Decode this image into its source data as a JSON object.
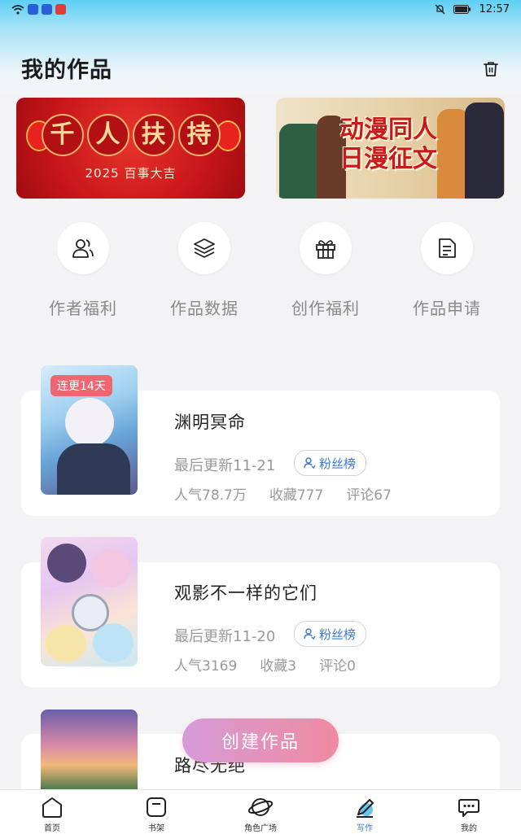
{
  "status_bar": {
    "time": "12:57"
  },
  "page": {
    "title": "我的作品"
  },
  "banners": [
    {
      "title": "千人扶持",
      "subtitle": "2025 百事大吉"
    },
    {
      "title_line1": "动漫同人",
      "title_line2": "日漫征文"
    }
  ],
  "features": [
    {
      "label": "作者福利",
      "icon": "user-group-icon"
    },
    {
      "label": "作品数据",
      "icon": "layers-icon"
    },
    {
      "label": "创作福利",
      "icon": "gift-icon"
    },
    {
      "label": "作品申请",
      "icon": "document-icon"
    }
  ],
  "works": [
    {
      "title": "渊明冥命",
      "badge": "连更14天",
      "updated": "最后更新11-21",
      "fans_label": "粉丝榜",
      "popularity": "人气78.7万",
      "favorites": "收藏777",
      "comments": "评论67"
    },
    {
      "title": "观影不一样的它们",
      "updated": "最后更新11-20",
      "fans_label": "粉丝榜",
      "popularity": "人气3169",
      "favorites": "收藏3",
      "comments": "评论0"
    },
    {
      "title": "路尽无绝"
    }
  ],
  "create_button": "创建作品",
  "tabs": [
    {
      "label": "首页"
    },
    {
      "label": "书架"
    },
    {
      "label": "角色广场"
    },
    {
      "label": "写作"
    },
    {
      "label": "我的"
    }
  ],
  "colors": {
    "accent": "#3a7bd5",
    "badge": "#f06572",
    "create_start": "#d59bd8",
    "create_end": "#f08aa0"
  }
}
